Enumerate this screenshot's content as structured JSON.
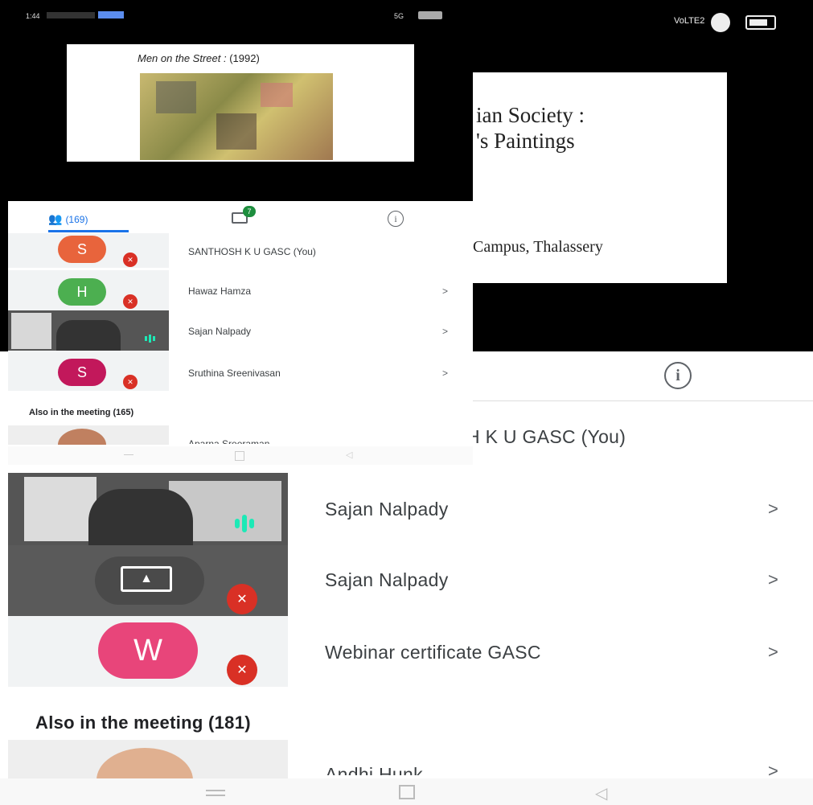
{
  "back": {
    "slide": {
      "title_line1": "ian Society :",
      "title_line2": "'s  Paintings",
      "subtitle": "Campus, Thalassery"
    },
    "status_bar": {
      "network": "VoLTE2"
    },
    "participants": [
      {
        "name": "H K U GASC (You)",
        "has_chevron": false
      },
      {
        "name": "Sajan Nalpady",
        "tile": "camera",
        "muted": false,
        "has_chevron": true
      },
      {
        "name": "Sajan Nalpady",
        "tile": "screen-share",
        "muted": true,
        "has_chevron": true
      },
      {
        "name": "Webinar certificate GASC",
        "avatar_letter": "W",
        "avatar_color": "#e8457a",
        "muted": true,
        "has_chevron": true
      }
    ],
    "also_in_meeting": "Also in the meeting (181)",
    "partial_next": {
      "name": "Andhi   Hunk"
    },
    "chevron": ">"
  },
  "front": {
    "status_bar": {
      "time": "1:44",
      "right": "5G"
    },
    "slide": {
      "caption_title": "Men on the Street :",
      "caption_year": "(1992)"
    },
    "tabs": {
      "people_count": "(169)",
      "chat_badge": "7"
    },
    "participants": [
      {
        "name": "SANTHOSH K U GASC (You)",
        "avatar_letter": "S",
        "avatar_color": "#e8643c",
        "muted": true,
        "has_chevron": false
      },
      {
        "name": "Hawaz Hamza",
        "avatar_letter": "H",
        "avatar_color": "#4caf50",
        "muted": true,
        "has_chevron": true
      },
      {
        "name": "Sajan Nalpady",
        "tile": "camera",
        "muted": false,
        "has_chevron": true
      },
      {
        "name": "Sruthina Sreenivasan",
        "avatar_letter": "S",
        "avatar_color": "#c2185b",
        "muted": true,
        "has_chevron": true
      }
    ],
    "also_in_meeting": "Also in the meeting (165)",
    "partial_next": {
      "name": "Aparna Sreeraman"
    },
    "chevron": ">"
  }
}
